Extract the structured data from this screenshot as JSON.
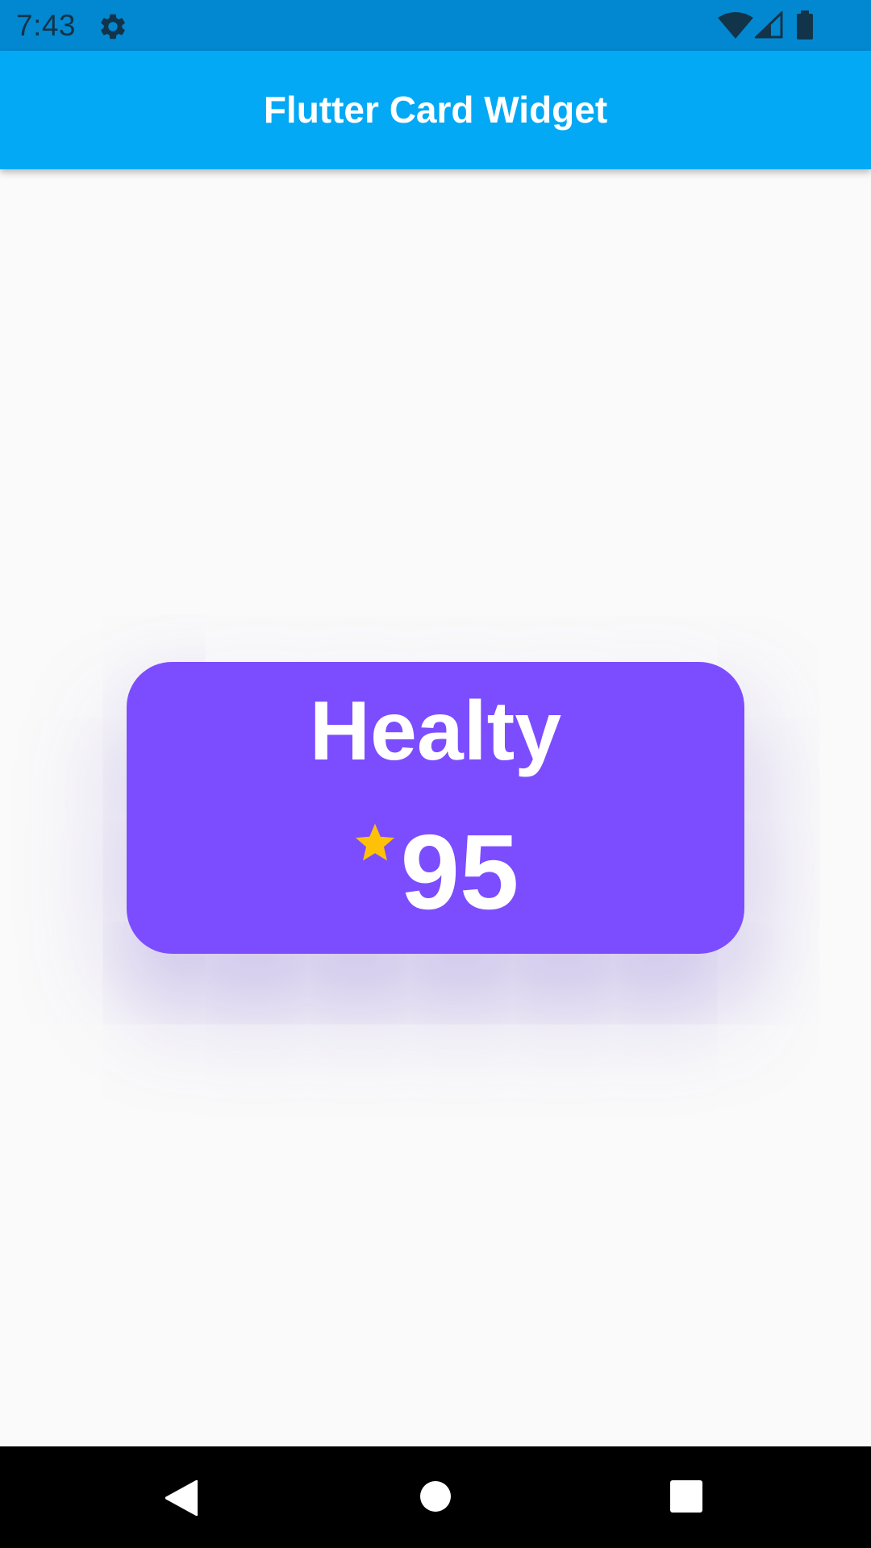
{
  "colors": {
    "status_bar": "#0288d1",
    "app_bar": "#03a9f4",
    "card": "#7c4dff",
    "star": "#ffc107",
    "nav_bar": "#000000"
  },
  "status_bar": {
    "time": "7:43",
    "icons": [
      "gear-icon",
      "wifi-icon",
      "cell-signal-icon",
      "battery-icon"
    ]
  },
  "app_bar": {
    "title": "Flutter Card Widget"
  },
  "card": {
    "title": "Healty",
    "score": "95",
    "icon": "star-icon"
  },
  "nav_bar": {
    "buttons": [
      "back-icon",
      "home-icon",
      "recents-icon"
    ]
  }
}
